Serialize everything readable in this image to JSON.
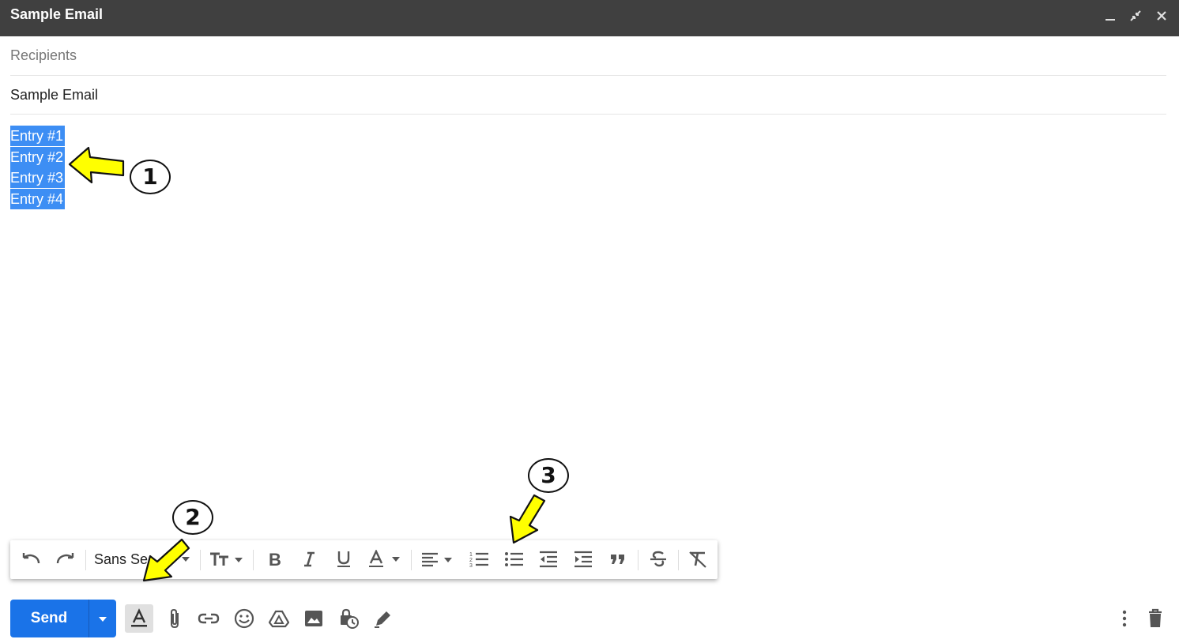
{
  "window": {
    "title": "Sample Email"
  },
  "compose": {
    "recipients_placeholder": "Recipients",
    "subject": "Sample Email",
    "body_lines": [
      "Entry #1",
      "Entry #2",
      "Entry #3",
      "Entry #4"
    ]
  },
  "toolbar": {
    "font": "Sans Se"
  },
  "send": {
    "label": "Send"
  },
  "annotations": [
    "1",
    "2",
    "3"
  ],
  "colors": {
    "titlebar": "#404040",
    "selection": "#3d8ef4",
    "send": "#1a73e8",
    "arrow": "#ffff00"
  }
}
